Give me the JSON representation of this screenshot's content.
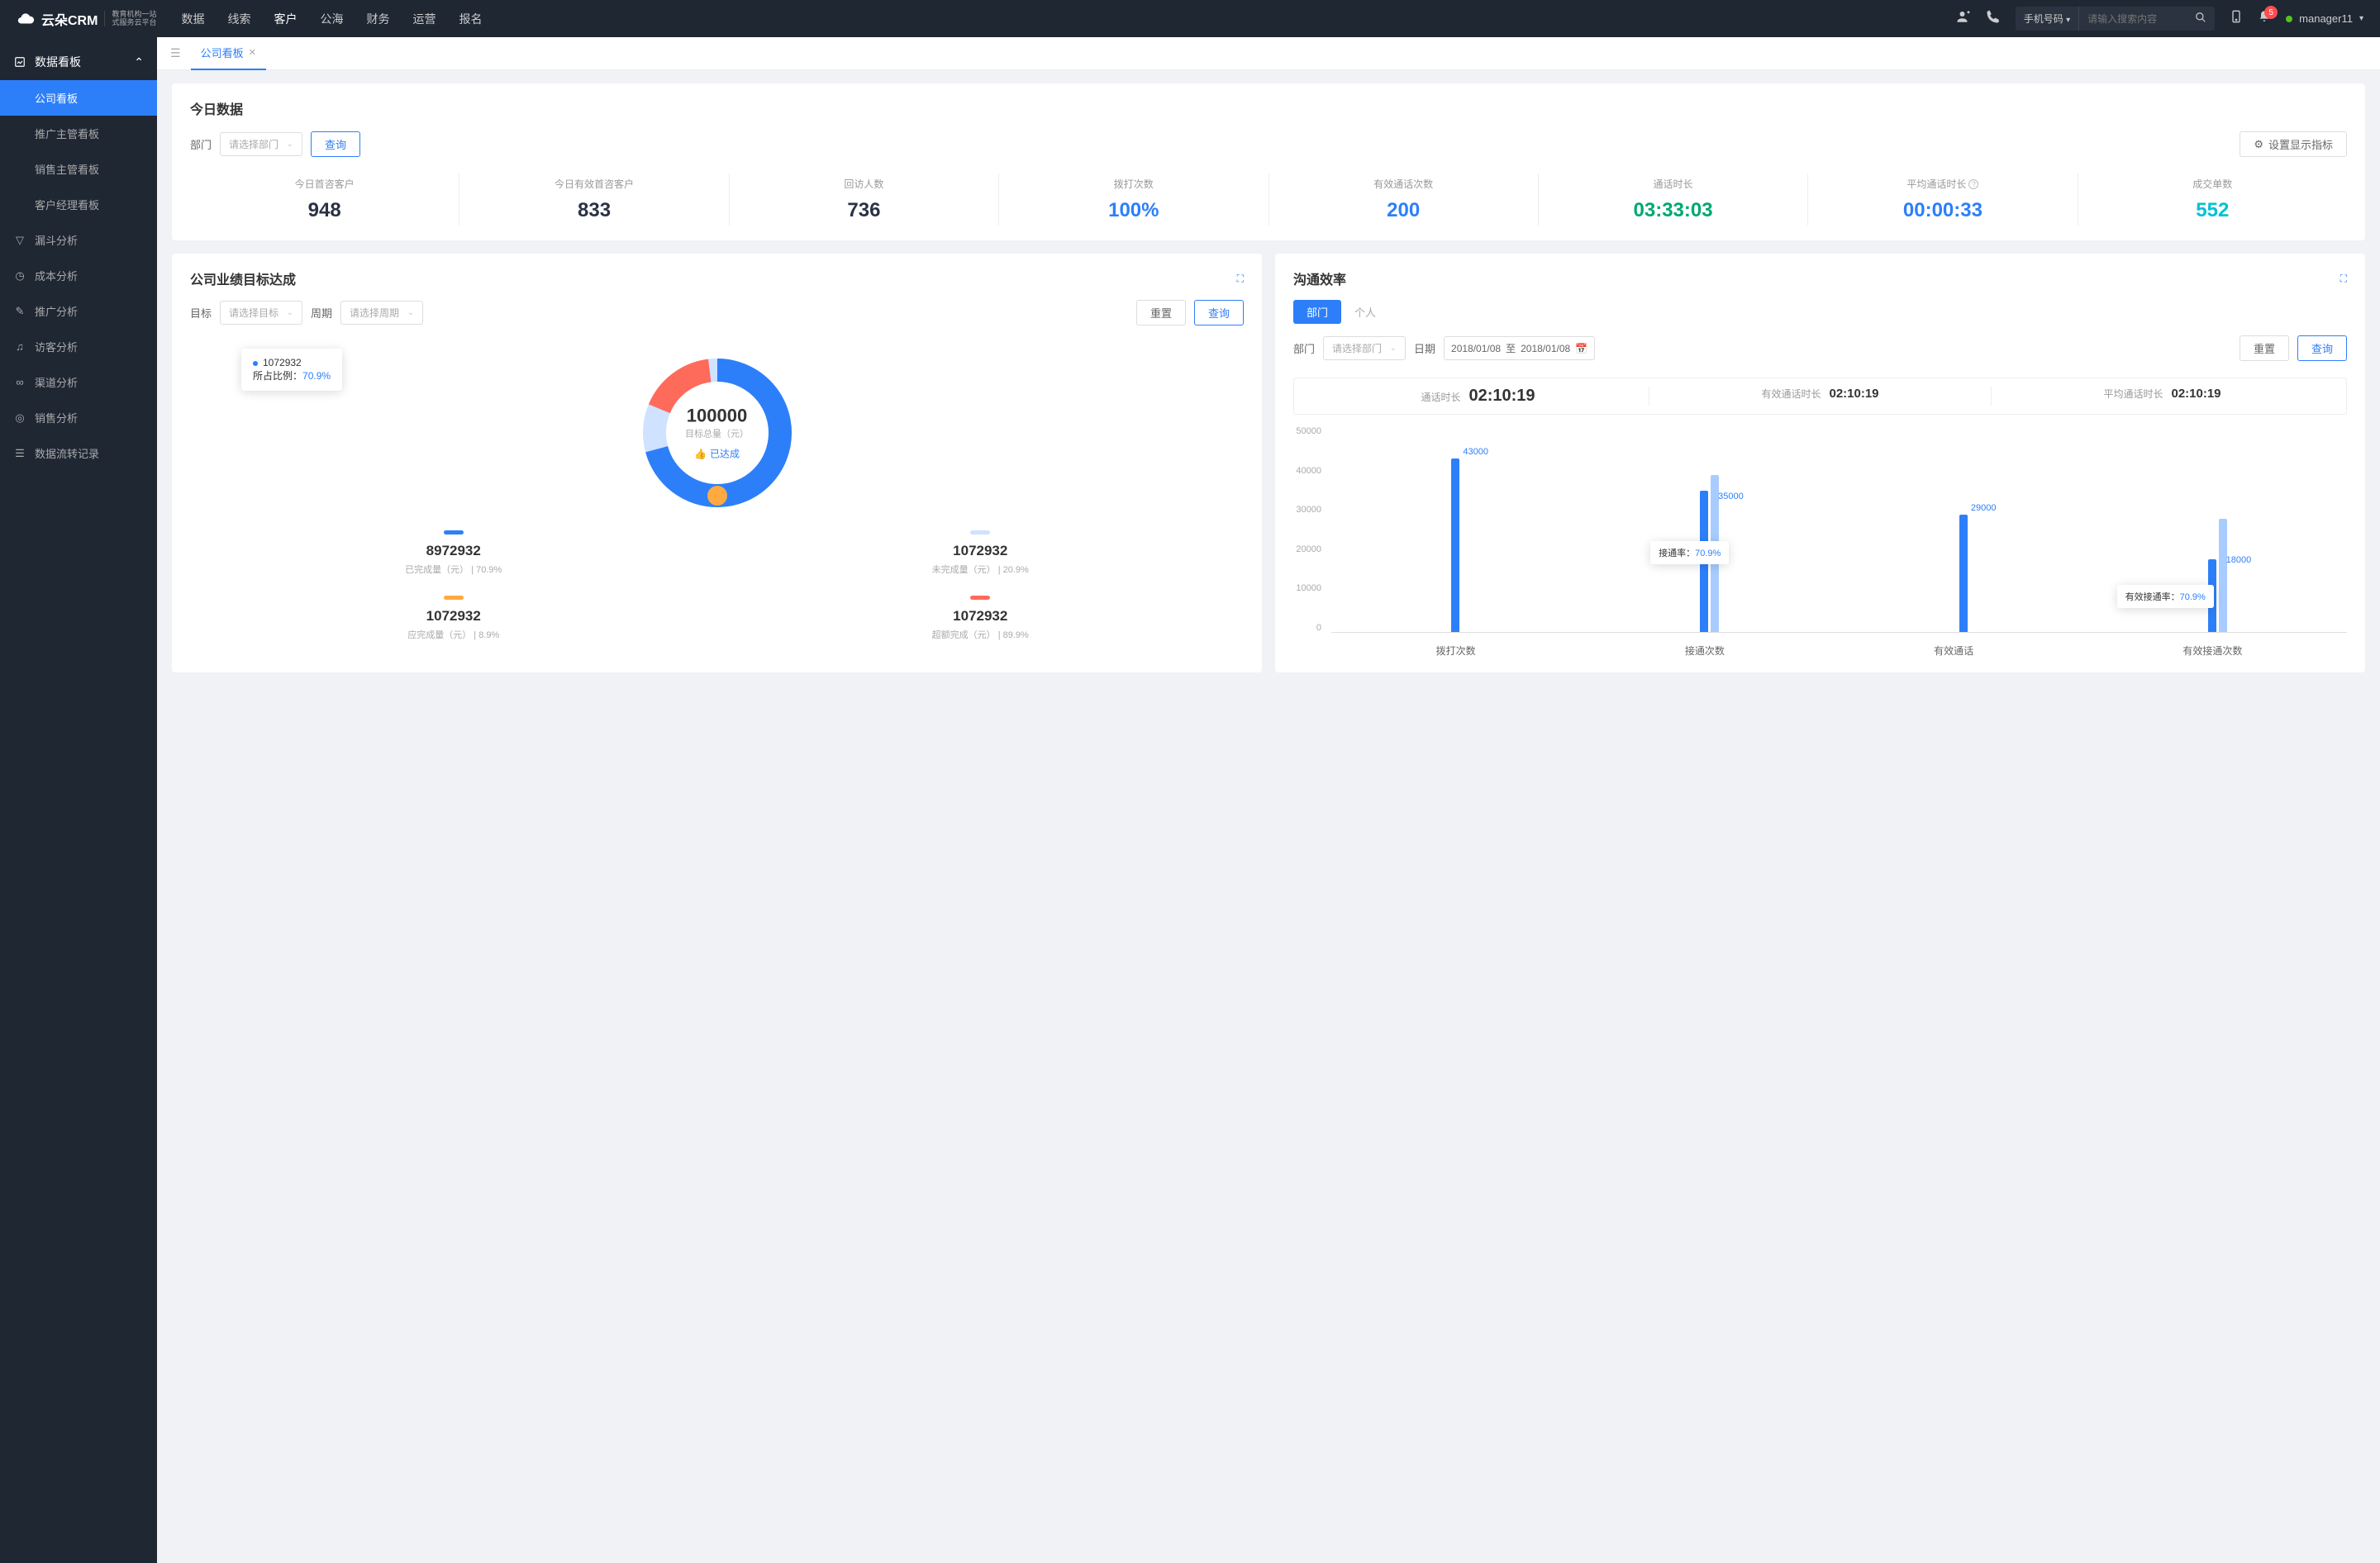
{
  "header": {
    "logo": "云朵CRM",
    "logo_sub1": "教育机构一站",
    "logo_sub2": "式服务云平台",
    "nav": [
      "数据",
      "线索",
      "客户",
      "公海",
      "财务",
      "运营",
      "报名"
    ],
    "nav_active": 2,
    "search_type": "手机号码",
    "search_placeholder": "请输入搜索内容",
    "notif_count": "5",
    "user": "manager11"
  },
  "sidebar": {
    "group": "数据看板",
    "subs": [
      "公司看板",
      "推广主管看板",
      "销售主管看板",
      "客户经理看板"
    ],
    "items": [
      {
        "icon": "funnel",
        "label": "漏斗分析"
      },
      {
        "icon": "clock",
        "label": "成本分析"
      },
      {
        "icon": "edit",
        "label": "推广分析"
      },
      {
        "icon": "headset",
        "label": "访客分析"
      },
      {
        "icon": "share",
        "label": "渠道分析"
      },
      {
        "icon": "target",
        "label": "销售分析"
      },
      {
        "icon": "list",
        "label": "数据流转记录"
      }
    ]
  },
  "tab": "公司看板",
  "today": {
    "title": "今日数据",
    "filter_label": "部门",
    "filter_placeholder": "请选择部门",
    "query_btn": "查询",
    "settings_btn": "设置显示指标",
    "metrics": [
      {
        "label": "今日首咨客户",
        "value": "948",
        "color": "mv-dark"
      },
      {
        "label": "今日有效首咨客户",
        "value": "833",
        "color": "mv-dark"
      },
      {
        "label": "回访人数",
        "value": "736",
        "color": "mv-dark"
      },
      {
        "label": "拨打次数",
        "value": "100%",
        "color": "mv-blue"
      },
      {
        "label": "有效通话次数",
        "value": "200",
        "color": "mv-blue"
      },
      {
        "label": "通话时长",
        "value": "03:33:03",
        "color": "mv-green"
      },
      {
        "label": "平均通话时长",
        "value": "00:00:33",
        "color": "mv-blue",
        "info": true
      },
      {
        "label": "成交单数",
        "value": "552",
        "color": "mv-cyan"
      }
    ]
  },
  "goal": {
    "title": "公司业绩目标达成",
    "target_label": "目标",
    "target_placeholder": "请选择目标",
    "period_label": "周期",
    "period_placeholder": "请选择周期",
    "reset_btn": "重置",
    "query_btn": "查询",
    "tooltip_value": "1072932",
    "tooltip_label": "所占比例：",
    "tooltip_pct": "70.9%",
    "center_value": "100000",
    "center_label": "目标总量（元）",
    "achieved": "已达成",
    "legend": [
      {
        "color": "lb-blue",
        "value": "8972932",
        "label": "已完成量（元）",
        "pct": "70.9%"
      },
      {
        "color": "lb-light",
        "value": "1072932",
        "label": "未完成量（元）",
        "pct": "20.9%"
      },
      {
        "color": "lb-orange",
        "value": "1072932",
        "label": "应完成量（元）",
        "pct": "8.9%"
      },
      {
        "color": "lb-red",
        "value": "1072932",
        "label": "超额完成（元）",
        "pct": "89.9%"
      }
    ]
  },
  "comm": {
    "title": "沟通效率",
    "seg": [
      "部门",
      "个人"
    ],
    "dept_label": "部门",
    "dept_placeholder": "请选择部门",
    "date_label": "日期",
    "date_from": "2018/01/08",
    "date_sep": "至",
    "date_to": "2018/01/08",
    "reset_btn": "重置",
    "query_btn": "查询",
    "stats": [
      {
        "label": "通话时长",
        "value": "02:10:19",
        "big": true
      },
      {
        "label": "有效通话时长",
        "value": "02:10:19"
      },
      {
        "label": "平均通话时长",
        "value": "02:10:19"
      }
    ],
    "tooltip1_label": "接通率：",
    "tooltip1_pct": "70.9%",
    "tooltip2_label": "有效接通率：",
    "tooltip2_pct": "70.9%"
  },
  "chart_data": {
    "type": "bar",
    "title": "沟通效率",
    "ylabel": "",
    "ylim": [
      0,
      50000
    ],
    "y_ticks": [
      0,
      10000,
      20000,
      30000,
      40000,
      50000
    ],
    "categories": [
      "拨打次数",
      "接通次数",
      "有效通话",
      "有效接通次数"
    ],
    "series": [
      {
        "name": "main",
        "values": [
          43000,
          35000,
          29000,
          18000
        ],
        "labels": [
          "43000",
          "35000",
          "29000",
          "18000"
        ]
      },
      {
        "name": "secondary",
        "values": [
          null,
          39000,
          null,
          28000
        ]
      }
    ]
  }
}
